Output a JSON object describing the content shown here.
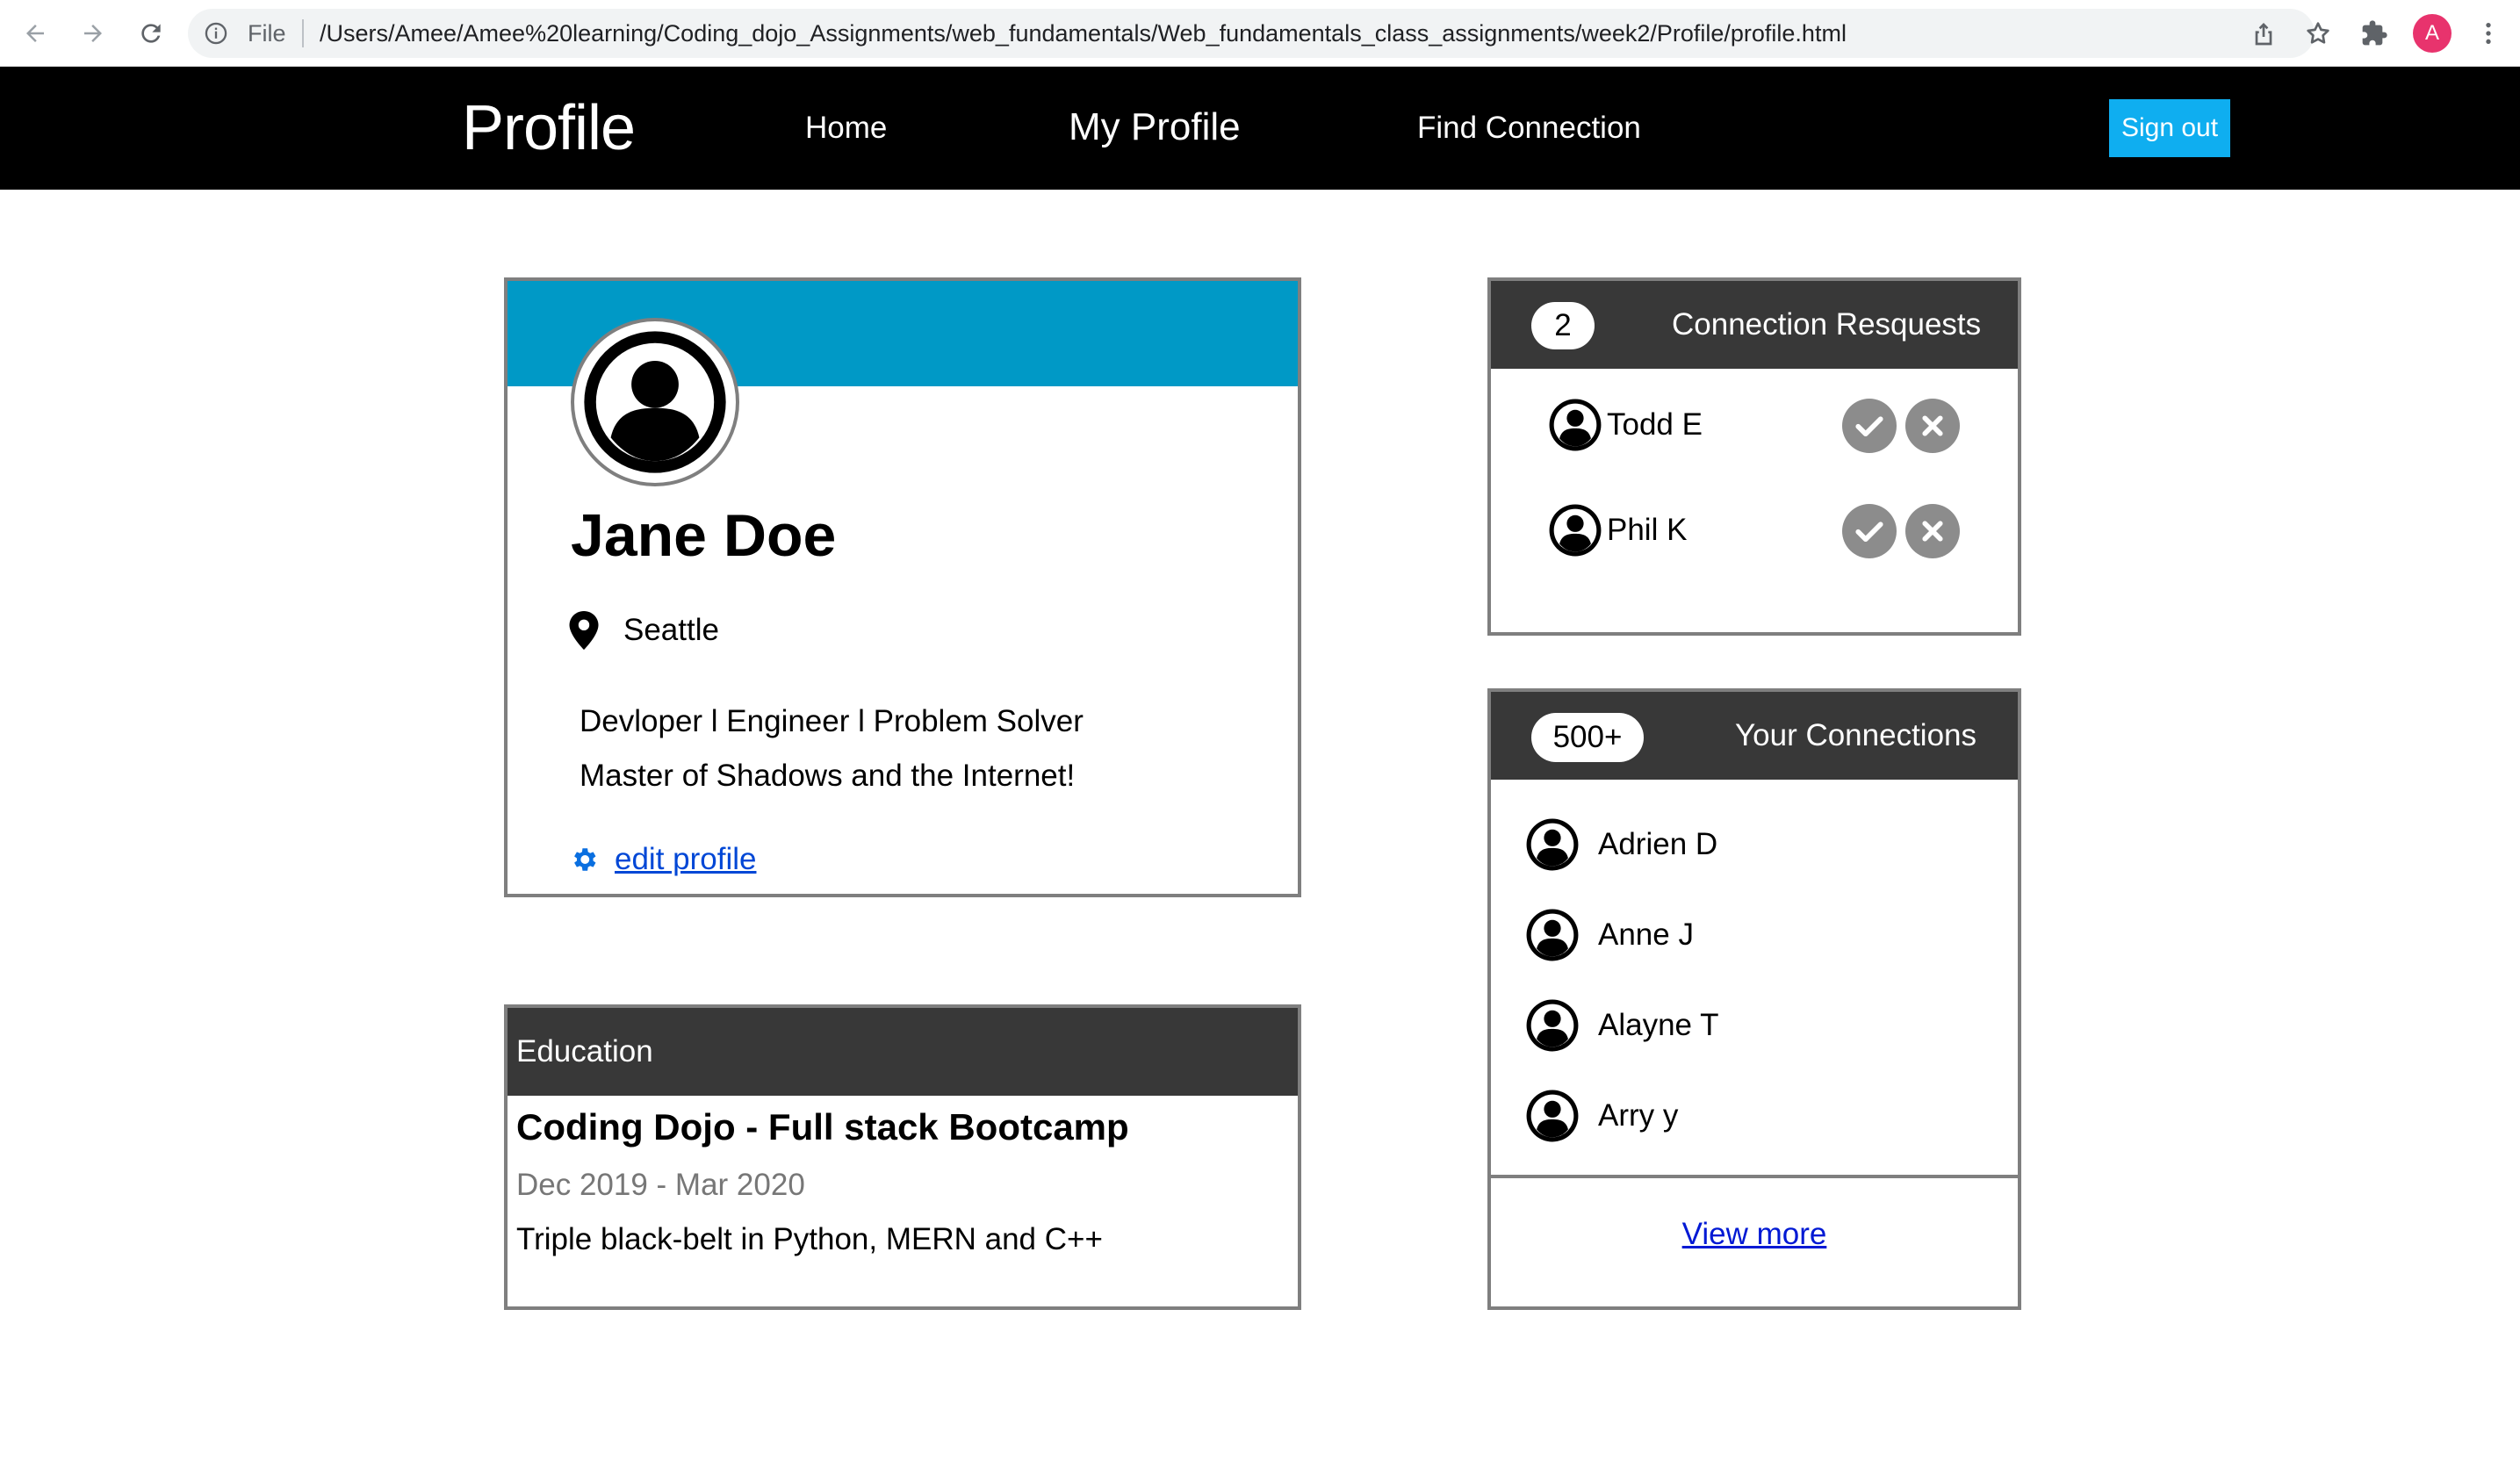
{
  "browser": {
    "omnibox_scheme": "File",
    "url": "/Users/Amee/Amee%20learning/Coding_dojo_Assignments/web_fundamentals/Web_fundamentals_class_assignments/week2/Profile/profile.html",
    "profile_initial": "A",
    "profile_color": "#e8336d"
  },
  "nav": {
    "brand": "Profile",
    "links": [
      "Home",
      "My Profile",
      "Find Connection"
    ],
    "sign_out": "Sign out",
    "sign_out_color": "#0faef0"
  },
  "profile": {
    "banner_color": "#0099c6",
    "name": "Jane Doe",
    "location": "Seattle",
    "bio_lines": [
      "Devloper l Engineer l Problem Solver",
      "Master of Shadows and the Internet!"
    ],
    "edit_label": "edit profile",
    "link_color": "#0047d6"
  },
  "education": {
    "header": "Education",
    "title": "Coding Dojo - Full stack Bootcamp",
    "dates": "Dec 2019 - Mar 2020",
    "description": "Triple black-belt in Python, MERN and C++"
  },
  "requests": {
    "count": "2",
    "title": "Connection Resquests",
    "items": [
      {
        "name": "Todd E"
      },
      {
        "name": "Phil K"
      }
    ]
  },
  "connections": {
    "count": "500+",
    "title": "Your Connections",
    "items": [
      {
        "name": "Adrien D"
      },
      {
        "name": "Anne J"
      },
      {
        "name": "Alayne T"
      },
      {
        "name": "Arry y"
      }
    ],
    "view_more": "View more"
  }
}
